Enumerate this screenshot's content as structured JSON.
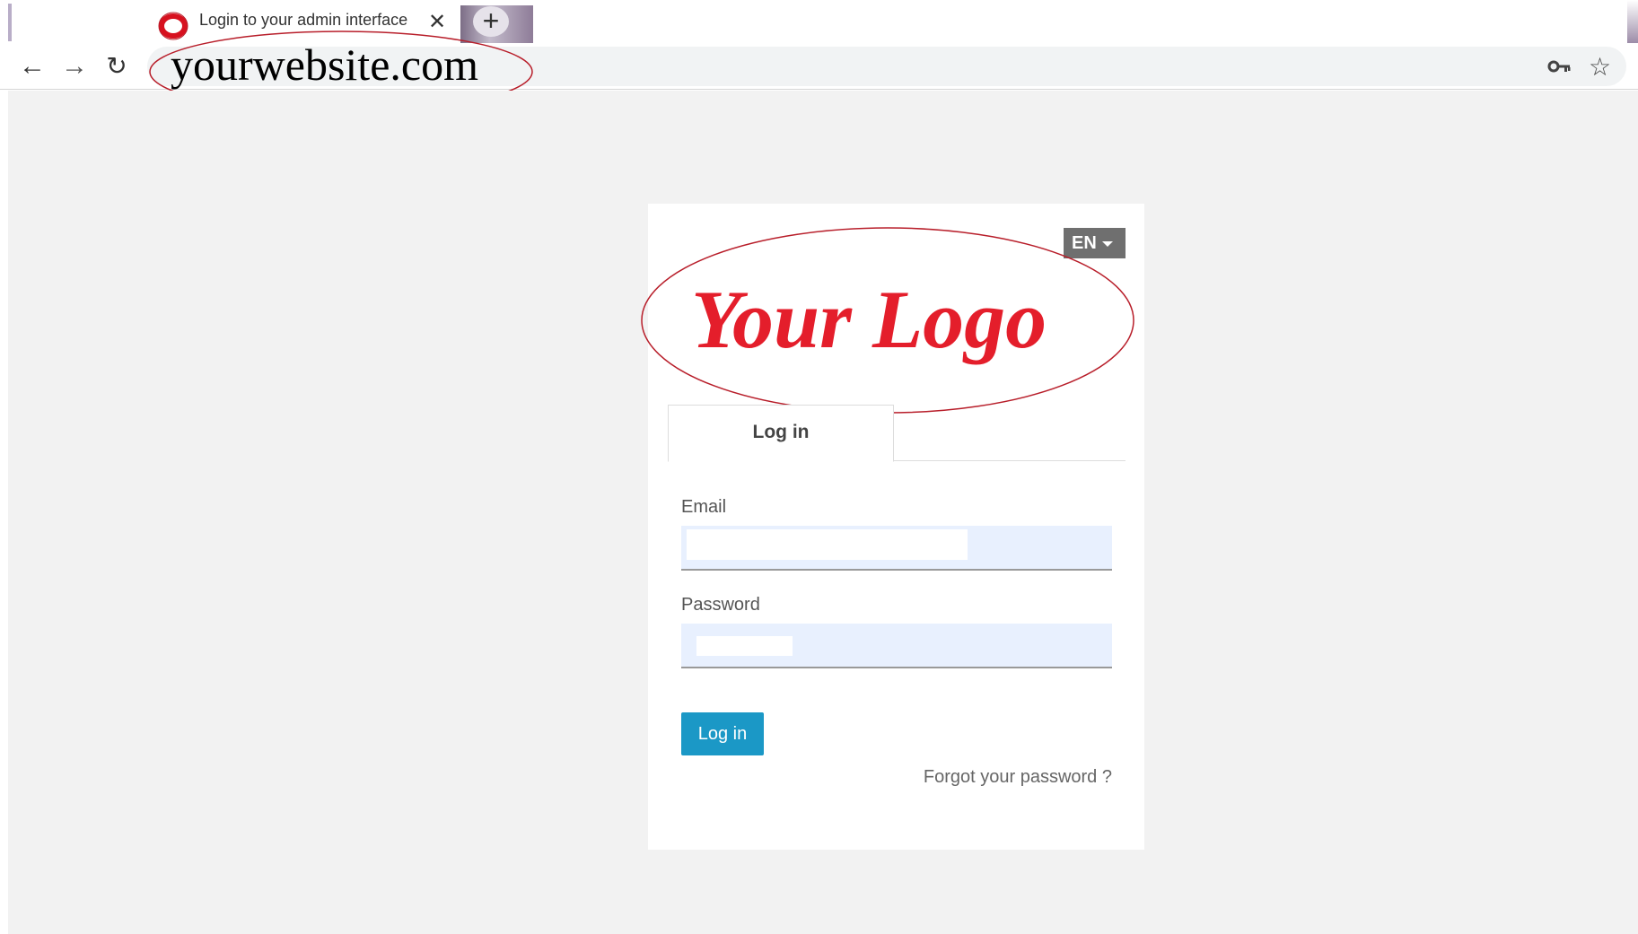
{
  "browser": {
    "tab": {
      "title": "Login to your admin interface",
      "close_label": "✕"
    },
    "new_tab_label": "+",
    "nav": {
      "back": "←",
      "forward": "→",
      "reload": "↻"
    },
    "address_bar": {
      "url": "yourwebsite.com"
    },
    "icons": {
      "favicon": "red-ring-icon",
      "key": "key-icon",
      "bookmark": "star-icon"
    }
  },
  "login_card": {
    "language": {
      "selected": "EN"
    },
    "logo_text": "Your Logo",
    "tabs": [
      {
        "label": "Log in",
        "active": true
      }
    ],
    "email": {
      "label": "Email",
      "value": ""
    },
    "password": {
      "label": "Password",
      "value": ""
    },
    "submit_label": "Log in",
    "forgot_link": "Forgot your password ?"
  },
  "colors": {
    "logo_red": "#e41e2b",
    "button_blue": "#1b98c6",
    "autofill_blue": "#e8f0fe",
    "page_bg": "#f2f2f2",
    "lang_btn": "#6f6f6f",
    "annotation_red": "#b81e2a"
  }
}
